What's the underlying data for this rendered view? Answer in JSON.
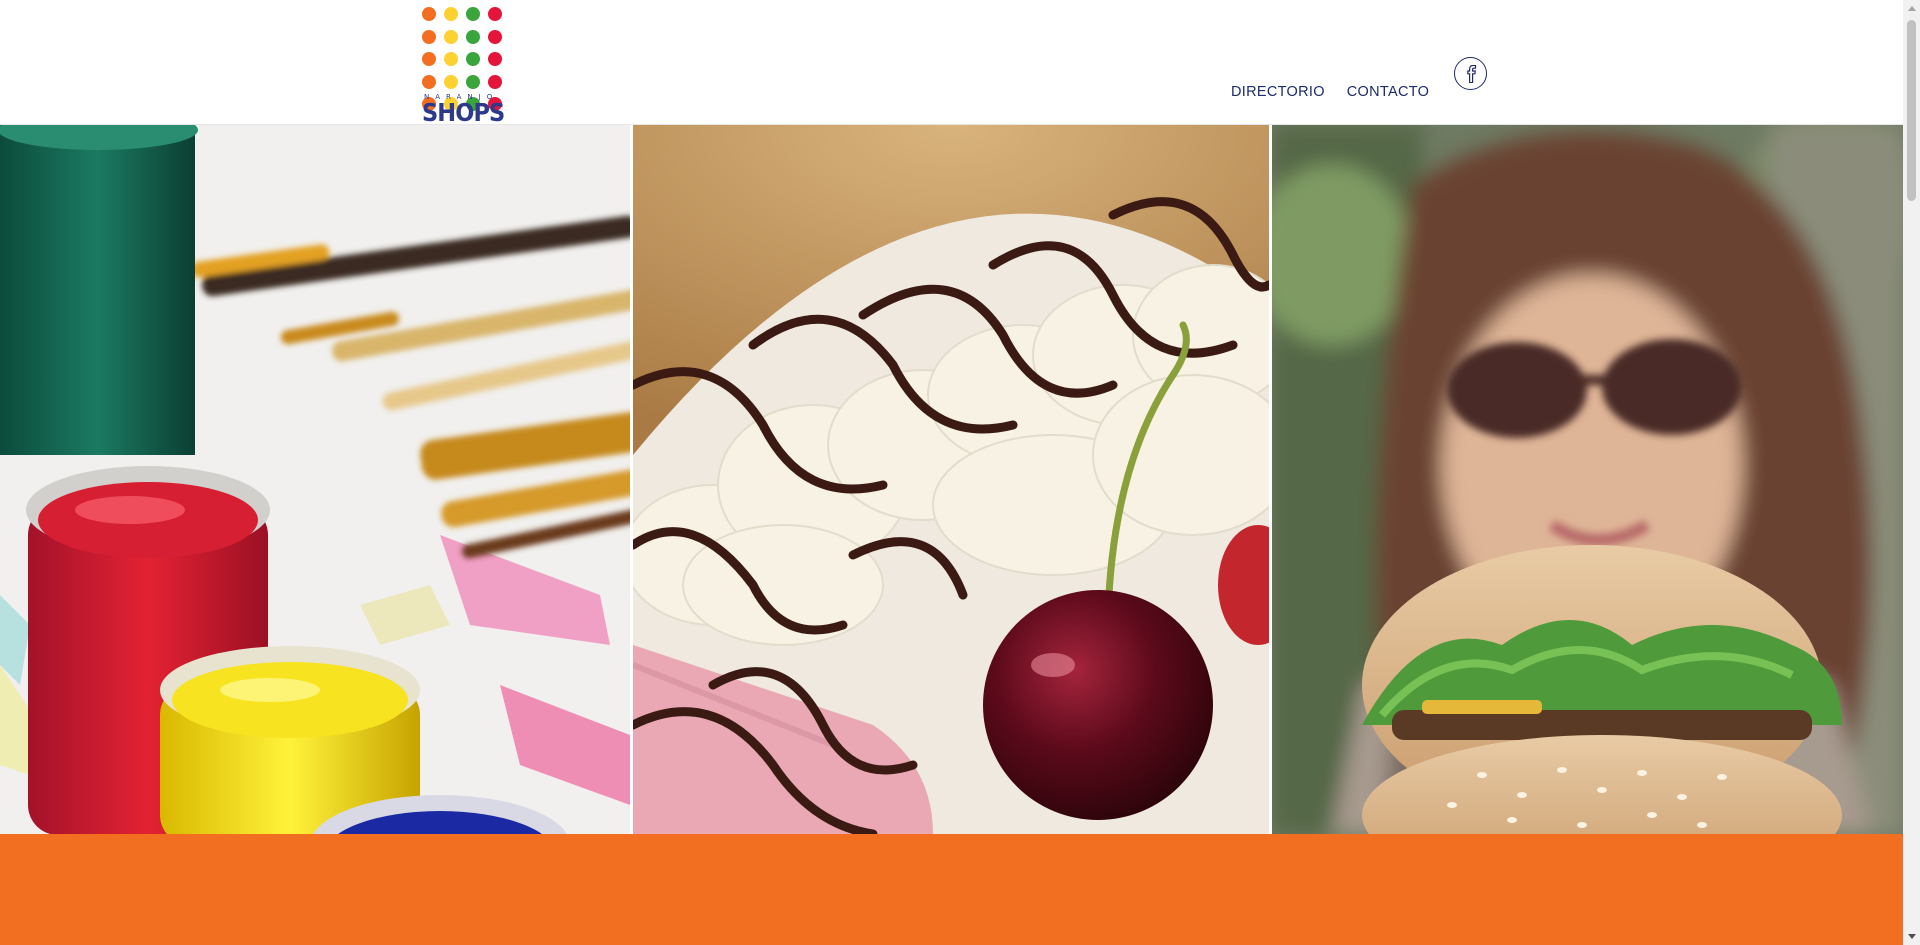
{
  "header": {
    "logo": {
      "dot_colors": [
        "#f26f21",
        "#fbd232",
        "#3aa53a",
        "#e4143b"
      ],
      "subtitle": "NARANJO",
      "title": "SHOPS"
    },
    "nav": [
      {
        "label": "DIRECTORIO"
      },
      {
        "label": "CONTACTO"
      }
    ],
    "social": {
      "icon": "facebook-icon"
    }
  },
  "hero": {
    "panels": [
      {
        "name": "paint-jars-image"
      },
      {
        "name": "ice-cream-cherry-image"
      },
      {
        "name": "woman-burger-image"
      }
    ]
  },
  "band": {
    "color": "#f26f21"
  },
  "colors": {
    "brand_blue": "#1d2b6b",
    "brand_orange": "#f26f21"
  }
}
